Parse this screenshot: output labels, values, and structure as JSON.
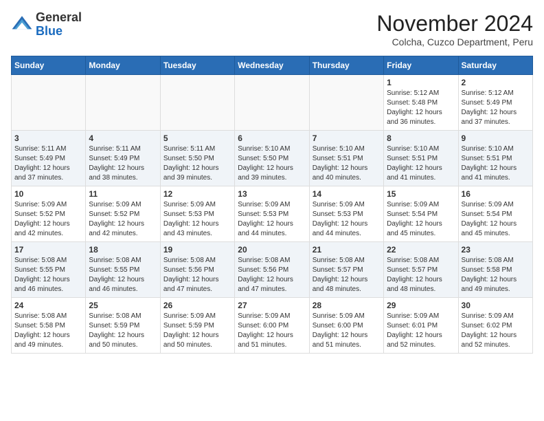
{
  "header": {
    "logo_general": "General",
    "logo_blue": "Blue",
    "main_title": "November 2024",
    "subtitle": "Colcha, Cuzco Department, Peru"
  },
  "weekdays": [
    "Sunday",
    "Monday",
    "Tuesday",
    "Wednesday",
    "Thursday",
    "Friday",
    "Saturday"
  ],
  "weeks": [
    [
      {
        "day": "",
        "info": ""
      },
      {
        "day": "",
        "info": ""
      },
      {
        "day": "",
        "info": ""
      },
      {
        "day": "",
        "info": ""
      },
      {
        "day": "",
        "info": ""
      },
      {
        "day": "1",
        "info": "Sunrise: 5:12 AM\nSunset: 5:48 PM\nDaylight: 12 hours and 36 minutes."
      },
      {
        "day": "2",
        "info": "Sunrise: 5:12 AM\nSunset: 5:49 PM\nDaylight: 12 hours and 37 minutes."
      }
    ],
    [
      {
        "day": "3",
        "info": "Sunrise: 5:11 AM\nSunset: 5:49 PM\nDaylight: 12 hours and 37 minutes."
      },
      {
        "day": "4",
        "info": "Sunrise: 5:11 AM\nSunset: 5:49 PM\nDaylight: 12 hours and 38 minutes."
      },
      {
        "day": "5",
        "info": "Sunrise: 5:11 AM\nSunset: 5:50 PM\nDaylight: 12 hours and 39 minutes."
      },
      {
        "day": "6",
        "info": "Sunrise: 5:10 AM\nSunset: 5:50 PM\nDaylight: 12 hours and 39 minutes."
      },
      {
        "day": "7",
        "info": "Sunrise: 5:10 AM\nSunset: 5:51 PM\nDaylight: 12 hours and 40 minutes."
      },
      {
        "day": "8",
        "info": "Sunrise: 5:10 AM\nSunset: 5:51 PM\nDaylight: 12 hours and 41 minutes."
      },
      {
        "day": "9",
        "info": "Sunrise: 5:10 AM\nSunset: 5:51 PM\nDaylight: 12 hours and 41 minutes."
      }
    ],
    [
      {
        "day": "10",
        "info": "Sunrise: 5:09 AM\nSunset: 5:52 PM\nDaylight: 12 hours and 42 minutes."
      },
      {
        "day": "11",
        "info": "Sunrise: 5:09 AM\nSunset: 5:52 PM\nDaylight: 12 hours and 42 minutes."
      },
      {
        "day": "12",
        "info": "Sunrise: 5:09 AM\nSunset: 5:53 PM\nDaylight: 12 hours and 43 minutes."
      },
      {
        "day": "13",
        "info": "Sunrise: 5:09 AM\nSunset: 5:53 PM\nDaylight: 12 hours and 44 minutes."
      },
      {
        "day": "14",
        "info": "Sunrise: 5:09 AM\nSunset: 5:53 PM\nDaylight: 12 hours and 44 minutes."
      },
      {
        "day": "15",
        "info": "Sunrise: 5:09 AM\nSunset: 5:54 PM\nDaylight: 12 hours and 45 minutes."
      },
      {
        "day": "16",
        "info": "Sunrise: 5:09 AM\nSunset: 5:54 PM\nDaylight: 12 hours and 45 minutes."
      }
    ],
    [
      {
        "day": "17",
        "info": "Sunrise: 5:08 AM\nSunset: 5:55 PM\nDaylight: 12 hours and 46 minutes."
      },
      {
        "day": "18",
        "info": "Sunrise: 5:08 AM\nSunset: 5:55 PM\nDaylight: 12 hours and 46 minutes."
      },
      {
        "day": "19",
        "info": "Sunrise: 5:08 AM\nSunset: 5:56 PM\nDaylight: 12 hours and 47 minutes."
      },
      {
        "day": "20",
        "info": "Sunrise: 5:08 AM\nSunset: 5:56 PM\nDaylight: 12 hours and 47 minutes."
      },
      {
        "day": "21",
        "info": "Sunrise: 5:08 AM\nSunset: 5:57 PM\nDaylight: 12 hours and 48 minutes."
      },
      {
        "day": "22",
        "info": "Sunrise: 5:08 AM\nSunset: 5:57 PM\nDaylight: 12 hours and 48 minutes."
      },
      {
        "day": "23",
        "info": "Sunrise: 5:08 AM\nSunset: 5:58 PM\nDaylight: 12 hours and 49 minutes."
      }
    ],
    [
      {
        "day": "24",
        "info": "Sunrise: 5:08 AM\nSunset: 5:58 PM\nDaylight: 12 hours and 49 minutes."
      },
      {
        "day": "25",
        "info": "Sunrise: 5:08 AM\nSunset: 5:59 PM\nDaylight: 12 hours and 50 minutes."
      },
      {
        "day": "26",
        "info": "Sunrise: 5:09 AM\nSunset: 5:59 PM\nDaylight: 12 hours and 50 minutes."
      },
      {
        "day": "27",
        "info": "Sunrise: 5:09 AM\nSunset: 6:00 PM\nDaylight: 12 hours and 51 minutes."
      },
      {
        "day": "28",
        "info": "Sunrise: 5:09 AM\nSunset: 6:00 PM\nDaylight: 12 hours and 51 minutes."
      },
      {
        "day": "29",
        "info": "Sunrise: 5:09 AM\nSunset: 6:01 PM\nDaylight: 12 hours and 52 minutes."
      },
      {
        "day": "30",
        "info": "Sunrise: 5:09 AM\nSunset: 6:02 PM\nDaylight: 12 hours and 52 minutes."
      }
    ]
  ]
}
